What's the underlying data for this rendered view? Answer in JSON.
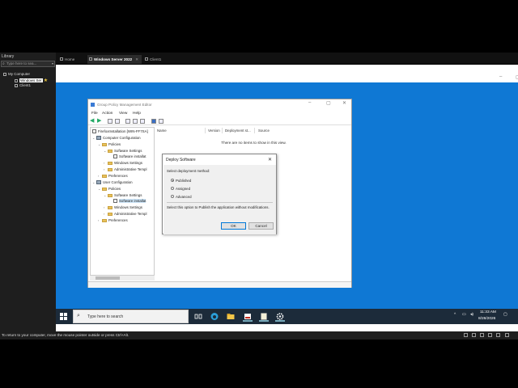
{
  "host": {
    "library_title": "Library",
    "search_placeholder": "Type here to sea...",
    "tree": {
      "root": "My Computer",
      "vm1": "Windows Ser",
      "vm2": "Client1"
    },
    "tabs": [
      {
        "label": "Home"
      },
      {
        "label": "Windows Server 2022"
      },
      {
        "label": "Client1"
      }
    ],
    "status_message": "To return to your computer, move the mouse pointer outside or press Ctrl+Alt."
  },
  "gpme": {
    "title": "Group Policy Management Editor",
    "menu": [
      "File",
      "Action",
      "View",
      "Help"
    ],
    "tree": {
      "root": "FirefoxInstallation [WIN-FF7SA]",
      "computer_config": "Computer Configuration",
      "policies": "Policies",
      "software_settings": "Software Settings",
      "software_install": "Software installat",
      "windows_settings": "Windows Settings",
      "admin_templates": "Administrative Templ",
      "preferences": "Preferences",
      "user_config": "User Configuration",
      "u_policies": "Policies",
      "u_software_settings": "Software Settings",
      "u_software_install": "Software installat",
      "u_windows_settings": "Windows Settings",
      "u_admin_templates": "Administrative Templ",
      "u_preferences": "Preferences"
    },
    "columns": [
      "Name",
      "Version",
      "Deployment st...",
      "Source"
    ],
    "empty_text": "There are no items to show in this view."
  },
  "dialog": {
    "title": "Deploy Software",
    "prompt": "Select deployment method:",
    "options": [
      {
        "label": "Published",
        "selected": true
      },
      {
        "label": "Assigned",
        "selected": false
      },
      {
        "label": "Advanced",
        "selected": false
      }
    ],
    "hint": "Select this option to Publish the application without modifications.",
    "ok_label": "OK",
    "cancel_label": "Cancel"
  },
  "taskbar": {
    "search_placeholder": "Type here to search",
    "time": "11:33 AM",
    "date": "8/28/2026",
    "accent": "#0f78d4"
  }
}
